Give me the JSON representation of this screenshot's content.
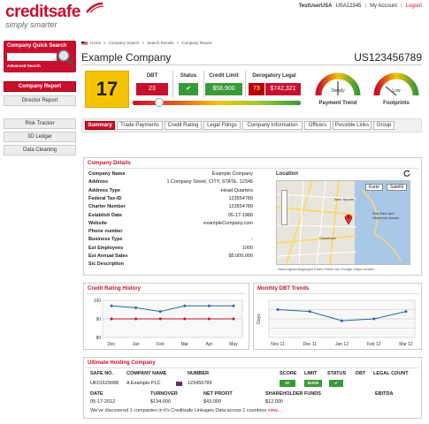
{
  "brand": {
    "name": "creditsafe",
    "tagline": "simply smarter",
    "color": "#c8102e"
  },
  "topnav": {
    "user": "TestUserUSA",
    "account_id": "USA12345",
    "separator": "|",
    "my_account": "My Account",
    "logout": "Logout"
  },
  "sidebar": {
    "quick_search_title": "Company Quick Search",
    "advanced_search": "Advanced Search",
    "items": [
      {
        "label": "Company Report",
        "active": true
      },
      {
        "label": "Director Report",
        "active": false
      },
      {
        "label": "Risk Tracker",
        "active": false
      },
      {
        "label": "3D Ledger",
        "active": false
      },
      {
        "label": "Data Cleaning",
        "active": false
      }
    ]
  },
  "breadcrumb": [
    "Home",
    ">",
    "Company Search",
    ">",
    "Search Results",
    ">",
    "Company Report"
  ],
  "company": {
    "name": "Example Company",
    "id": "US123456789"
  },
  "score": {
    "value": "17",
    "dbt_label": "DBT",
    "dbt_value": "23",
    "status_label": "Status",
    "status_value": "✔",
    "credit_limit_label": "Credit Limit",
    "credit_limit_value": "$58,900",
    "derog_label": "Derogatory Legal",
    "derog_count": "73",
    "derog_amount": "$742,321",
    "risk_position": 0.16
  },
  "gauges": [
    {
      "label": "Payment Trend",
      "reading": "Steady",
      "level": 0.5
    },
    {
      "label": "Footprints",
      "reading": "Low",
      "level": 0.15
    }
  ],
  "tabs": [
    {
      "label": "Summary",
      "active": true
    },
    {
      "label": "Trade Payments",
      "active": false
    },
    {
      "label": "Credit Rating",
      "active": false
    },
    {
      "label": "Legal Filings",
      "active": false
    },
    {
      "label": "Company Information",
      "active": false
    },
    {
      "label": "Officers",
      "active": false
    },
    {
      "label": "Possible Links",
      "active": false
    },
    {
      "label": "Group",
      "active": false
    }
  ],
  "details": {
    "title": "Company Details",
    "location_title": "Location",
    "rows": [
      {
        "label": "Company Name",
        "value": "Example Company"
      },
      {
        "label": "Address",
        "value": "1 Company Street, CITY, STATE. 12345"
      },
      {
        "label": "Address Type",
        "value": "Head Quarters"
      },
      {
        "label": "Federal Tax-ID",
        "value": "123554789"
      },
      {
        "label": "Charter Number",
        "value": "123554789"
      },
      {
        "label": "Establish Date",
        "value": "05-17-1980"
      },
      {
        "label": "Website",
        "value": "exampleCompany.com"
      },
      {
        "label": "Phone number",
        "value": ""
      },
      {
        "label": "Business Type",
        "value": "-"
      },
      {
        "label": "Est Employees",
        "value": "1000"
      },
      {
        "label": "Est Annual Sales",
        "value": "$5,000,000"
      },
      {
        "label": "Sic Description",
        "value": ""
      }
    ],
    "map": {
      "btn_map": "Karte",
      "btn_sat": "Satellit",
      "labels": [
        "Town Square",
        "Downtown",
        "Star Park and Historical Islands"
      ],
      "footer": "Nutzungsbedingungen  Einen Fehler bei Google Maps melden"
    }
  },
  "credit_history": {
    "title": "Credit Rating History",
    "chart_data": {
      "type": "line",
      "categories": [
        "Dec",
        "Jan",
        "Feb",
        "Mar",
        "Apr",
        "May"
      ],
      "ylim": [
        80,
        100
      ],
      "yticks": [
        "100",
        "90",
        "80"
      ],
      "series": [
        {
          "values": [
            97,
            96,
            94,
            97,
            97,
            97
          ],
          "color": "#2f64a6"
        },
        {
          "values": [
            90,
            90,
            90,
            90,
            90,
            90
          ],
          "color": "#c8102e"
        }
      ]
    }
  },
  "dbt_trends": {
    "title": "Monthly DBT Trends",
    "chart_data": {
      "type": "line",
      "categories": [
        "Nov 11",
        "Dec 11",
        "Jan 12",
        "Feb 12",
        "Mar 12"
      ],
      "ylabel": "Days",
      "series": [
        {
          "values": [
            25,
            24,
            19,
            20,
            24
          ],
          "color": "#2f64a6"
        }
      ]
    }
  },
  "holding": {
    "title": "Ultimate Holding Company",
    "headers": [
      "SAFE NO.",
      "COMPANY NAME",
      "NUMBER",
      "SCORE",
      "LIMIT",
      "STATUS",
      "DBT",
      "LEGAL COUNT"
    ],
    "row": {
      "safe_no": "UK01629088",
      "name": "A Example PLC",
      "number": "123456789",
      "score": "97",
      "limit": "$100k",
      "status": "✔"
    },
    "fin_headers": [
      "DATE",
      "TURNOVER",
      "NET PROFIT",
      "SHAREHOLDER FUNDS",
      "EBITDA"
    ],
    "fin_row": {
      "date": "05-17-2012",
      "turnover": "$134,000",
      "net_profit": "$43,000",
      "funds": "$12,000",
      "ebitda": ""
    },
    "note": "We've discovered 1 companies in it's Creditsafe Linkages Data across 1 countries",
    "note_link": "view..."
  }
}
